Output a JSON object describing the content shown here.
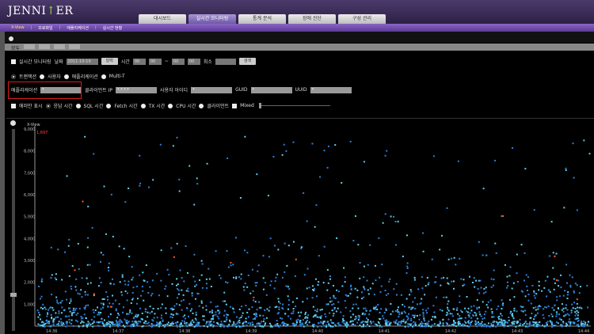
{
  "header": {
    "logo": "JENNIFER",
    "tabs": [
      "대시보드",
      "실시간 모니터링",
      "통계 분석",
      "장애 진단",
      "구성 관리"
    ],
    "active_tab": 1
  },
  "submenu": {
    "items": [
      "X-View",
      "프로파일",
      "애플리케이션",
      "실시간 현황"
    ],
    "active": 0
  },
  "panel": {
    "tab_label": "모두"
  },
  "controls": {
    "realtime_label": "실시간 모니터링",
    "date_label": "날짜",
    "date_value": "2011-10-19",
    "calendar_btn": "달력",
    "time_label": "시간",
    "time_from_h": "00",
    "time_from_m": "00",
    "tilde": "~",
    "time_to_h": "00",
    "time_to_m": "00",
    "min_label": "최소",
    "search_btn": "검색",
    "radio_transaction": "트랜잭션",
    "radio_user": "사용자",
    "radio_app": "애플리케이션",
    "radio_multit": "Multi-T",
    "app_label": "애플리케이션",
    "app_value": "*",
    "client_ip_label": "클라이언트 IP",
    "client_ip_value": "*.*.*.*",
    "user_id_label": "사용자 아이디",
    "user_id_value": "*",
    "guid_label": "GUID",
    "guid_value": "*",
    "uuid_label": "UUID",
    "uuid_value": "*",
    "error_only": "에러만 표시",
    "radio_response": "응답 시간",
    "radio_sql": "SQL 시간",
    "radio_fetch": "Fetch 시간",
    "radio_tx": "TX 시간",
    "radio_cpu": "CPU 시간",
    "radio_client": "클라이언트",
    "mixed": "Mixed"
  },
  "chart_data": {
    "type": "scatter",
    "title": "X-View",
    "ymax_label": "1,697",
    "yticks": [
      "9,000",
      "8,000",
      "7,000",
      "6,000",
      "5,000",
      "4,000",
      "3,000",
      "2,000",
      "1,000"
    ],
    "xticks": [
      "14:36",
      "14:37",
      "14:38",
      "14:39",
      "14:40",
      "14:41",
      "14:42",
      "14:43",
      "14:44"
    ],
    "ylim": [
      0,
      9000
    ],
    "grid": false,
    "colors": {
      "normal": "#2f7fd8",
      "fast": "#5fd0ec",
      "error": "#ff5a1e",
      "background": "#000000",
      "axis": "#bbbbbb"
    }
  }
}
